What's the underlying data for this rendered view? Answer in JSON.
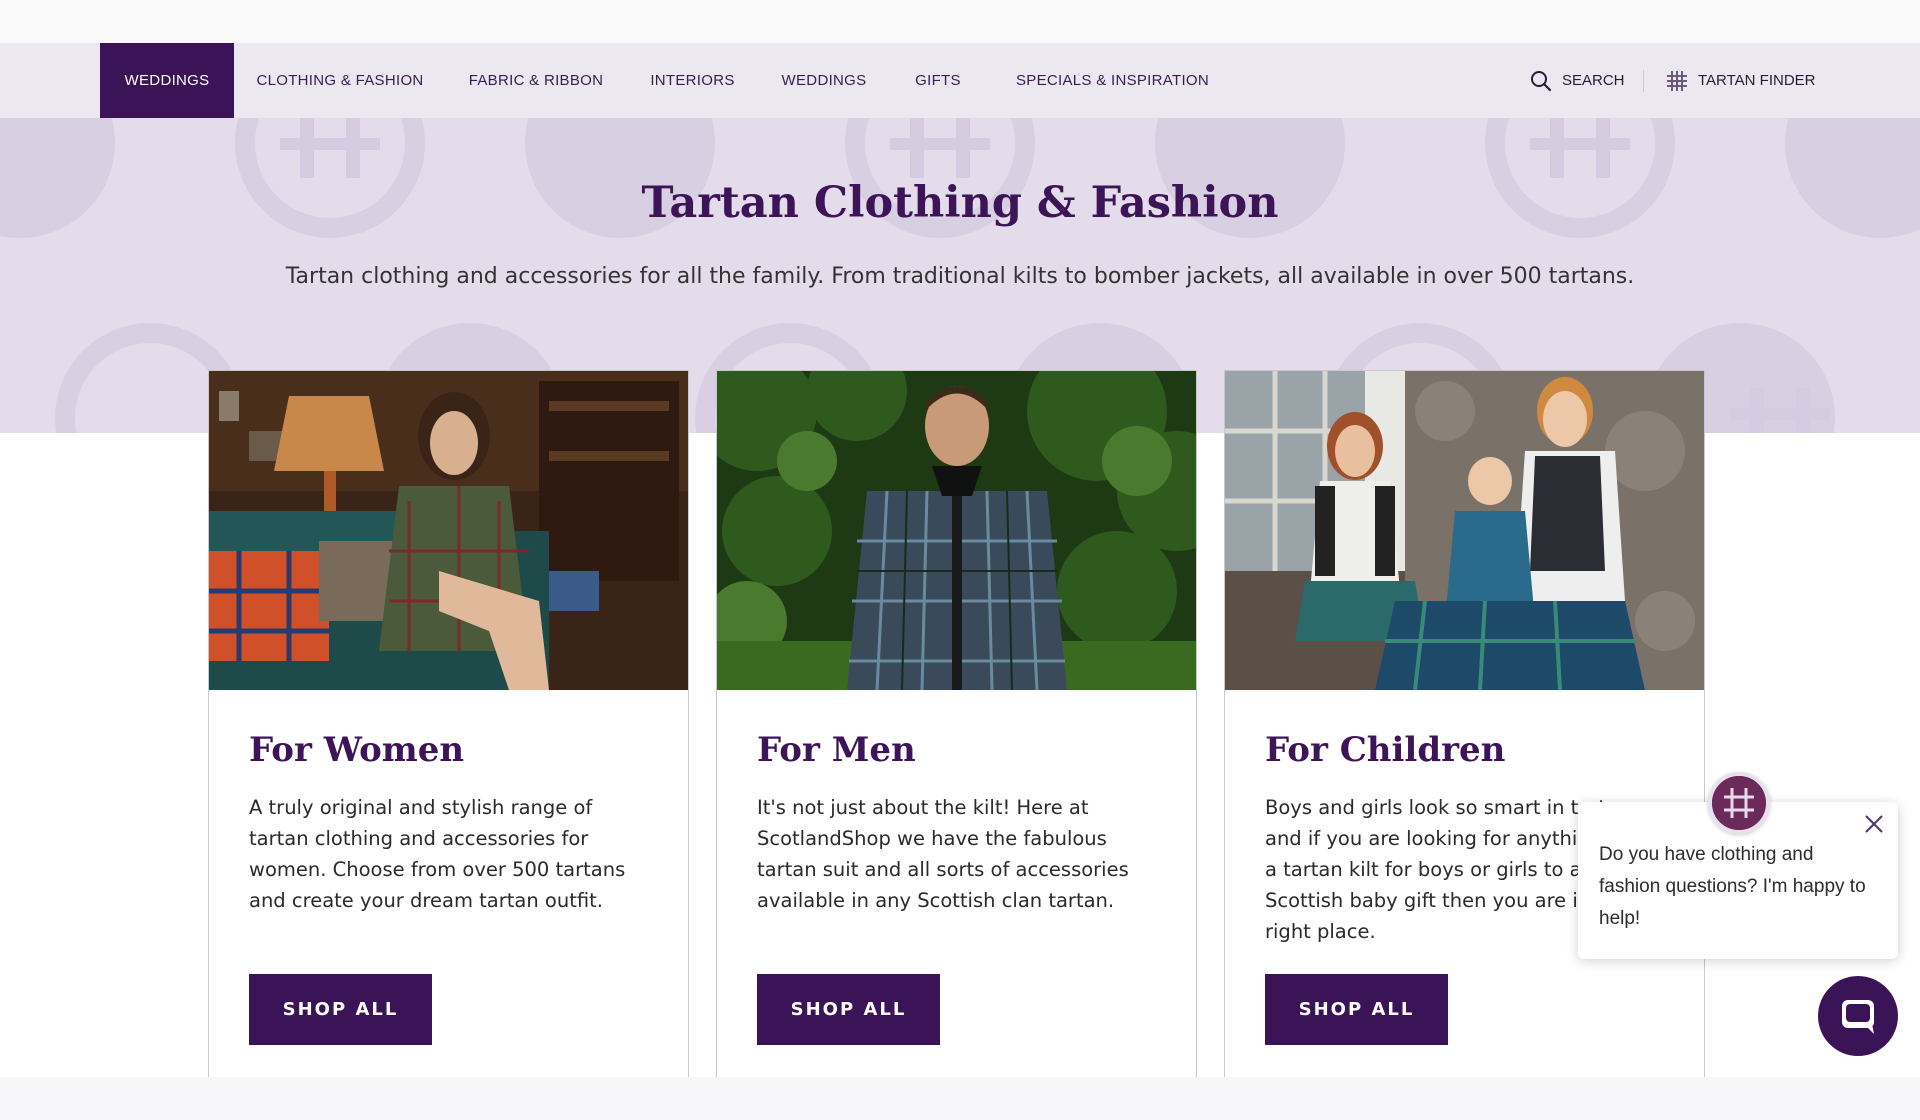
{
  "nav": {
    "items": [
      {
        "label": "WEDDINGS"
      },
      {
        "label": "CLOTHING & FASHION"
      },
      {
        "label": "FABRIC & RIBBON"
      },
      {
        "label": "INTERIORS"
      },
      {
        "label": "WEDDINGS"
      },
      {
        "label": "GIFTS"
      },
      {
        "label": "SPECIALS & INSPIRATION"
      }
    ],
    "search_label": "SEARCH",
    "tartan_finder_label": "TARTAN FINDER"
  },
  "hero": {
    "title": "Tartan Clothing & Fashion",
    "subtitle": "Tartan clothing and accessories for all the family. From traditional kilts to bomber jackets, all available in over 500 tartans."
  },
  "cards": [
    {
      "title": "For Women",
      "description": "A truly original and stylish range of tartan clothing and accessories for women. Choose from over 500 tartans and create your dream tartan outfit.",
      "button": "SHOP ALL"
    },
    {
      "title": "For Men",
      "description": "It's not just about the kilt! Here at ScotlandShop we have the fabulous tartan suit and all sorts of accessories available in any Scottish clan tartan.",
      "button": "SHOP ALL"
    },
    {
      "title": "For Children",
      "description": "Boys and girls look so smart in tartan and if you are looking for anything from a tartan kilt for boys or girls to a Scottish baby gift then you are in the right place.",
      "button": "SHOP ALL"
    }
  ],
  "chat": {
    "message": "Do you have clothing and fashion questions? I'm happy to help!"
  },
  "colors": {
    "brand_purple": "#3b1458",
    "hero_bg": "#e4dceb",
    "nav_bg": "#ebe9ef"
  }
}
